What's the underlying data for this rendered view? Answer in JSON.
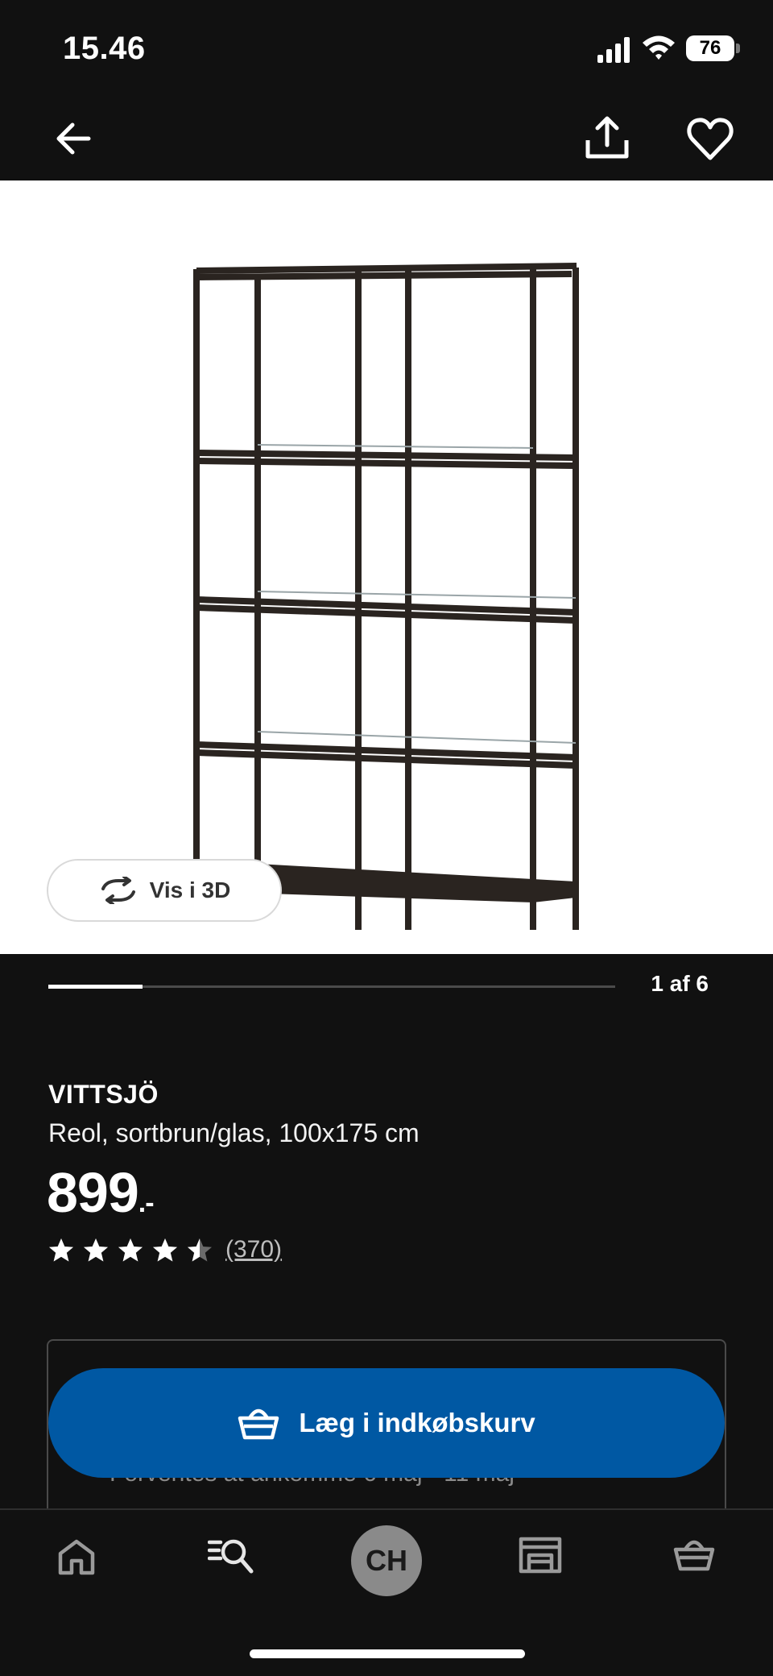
{
  "status_bar": {
    "time": "15.46",
    "battery": "76"
  },
  "header": {
    "back_icon": "arrow-left-icon",
    "share_icon": "share-icon",
    "favorite_icon": "heart-icon"
  },
  "gallery": {
    "view_3d_label": "Vis i 3D",
    "counter": "1 af 6",
    "current_index": 1,
    "total_images": 6
  },
  "product": {
    "name": "VITTSJÖ",
    "description": "Reol, sortbrun/glas, 100x175 cm",
    "price": "899",
    "price_suffix": ".-",
    "rating": 4.5,
    "rating_max": 5,
    "review_count": "(370)"
  },
  "delivery": {
    "text": "Forventes at ankomme 6 maj - 11 maj"
  },
  "cart_button": {
    "label": "Læg i indkøbskurv",
    "color": "#0058a3"
  },
  "bottom_nav": {
    "items": [
      "home-icon",
      "search-list-icon",
      "profile-avatar",
      "store-icon",
      "basket-icon"
    ],
    "profile_initials": "CH"
  }
}
